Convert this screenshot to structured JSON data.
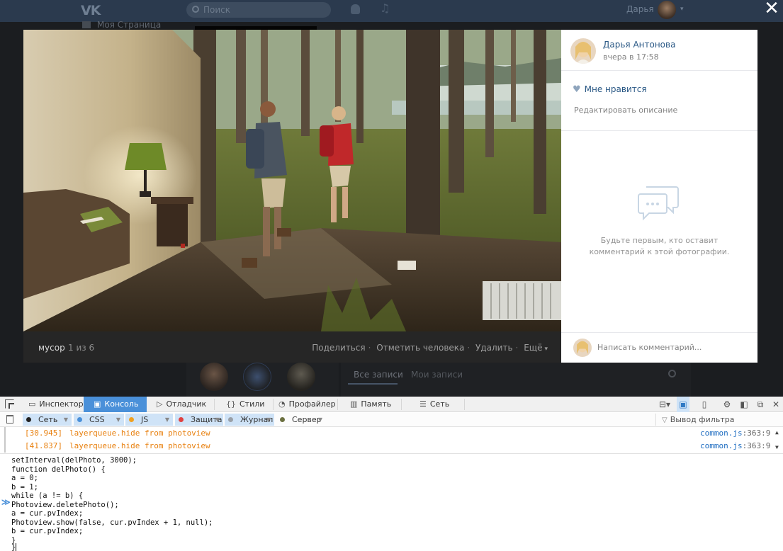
{
  "vk": {
    "logo": "VK",
    "search_placeholder": "Поиск",
    "user_name": "Дарья",
    "close_symbol": "✕",
    "nav_my_page": "Моя Страница",
    "wall_tab_all": "Все записи",
    "wall_tab_mine": "Мои записи"
  },
  "photo": {
    "album": "мусор",
    "counter": "1 из 6",
    "actions": {
      "share": "Поделиться",
      "tag": "Отметить человека",
      "delete": "Удалить",
      "more": "Ещё"
    },
    "author_name": "Дарья Антонова",
    "time": "вчера в 17:58",
    "like_label": "Мне нравится",
    "edit_description": "Редактировать описание",
    "empty_comments": "Будьте первым, кто оставит комментарий к этой фотографии.",
    "comment_placeholder": "Написать комментарий..."
  },
  "devtools": {
    "tabs": [
      {
        "label": "Инспектор",
        "icon": "inspector-icon"
      },
      {
        "label": "Консоль",
        "icon": "console-icon"
      },
      {
        "label": "Отладчик",
        "icon": "debugger-icon"
      },
      {
        "label": "Стили",
        "icon": "braces-icon"
      },
      {
        "label": "Профайлер",
        "icon": "profiler-icon"
      },
      {
        "label": "Память",
        "icon": "memory-icon"
      },
      {
        "label": "Сеть",
        "icon": "network-icon"
      }
    ],
    "filters": [
      {
        "label": "Сеть",
        "color": "#222222"
      },
      {
        "label": "CSS",
        "color": "#4a90d9"
      },
      {
        "label": "JS",
        "color": "#f0a020"
      },
      {
        "label": "Защита",
        "color": "#e04040"
      },
      {
        "label": "Журнал",
        "color": "#9aa0a8"
      },
      {
        "label": "Сервер",
        "color": "#6b7040"
      }
    ],
    "filter_placeholder": "Вывод фильтра",
    "log": [
      {
        "time": "[30.945]",
        "message": "layerqueue.hide from photoview",
        "source": "common.js",
        "line": ":363:9"
      },
      {
        "time": "[41.837]",
        "message": "layerqueue.hide from photoview",
        "source": "common.js",
        "line": ":363:9"
      }
    ],
    "code": [
      "setInterval(delPhoto, 3000);",
      "function delPhoto() {",
      "a = 0;",
      "b = 1;",
      "while (a != b) {",
      "Photoview.deletePhoto();",
      "a = cur.pvIndex;",
      "Photoview.show(false, cur.pvIndex + 1, null);",
      "b = cur.pvIndex;",
      "}",
      "}"
    ]
  },
  "colors": {
    "vk_link": "#2a5885",
    "devtools_active": "#4a90d9",
    "log_warn": "#e8800f",
    "source_link": "#1f6dc1"
  }
}
